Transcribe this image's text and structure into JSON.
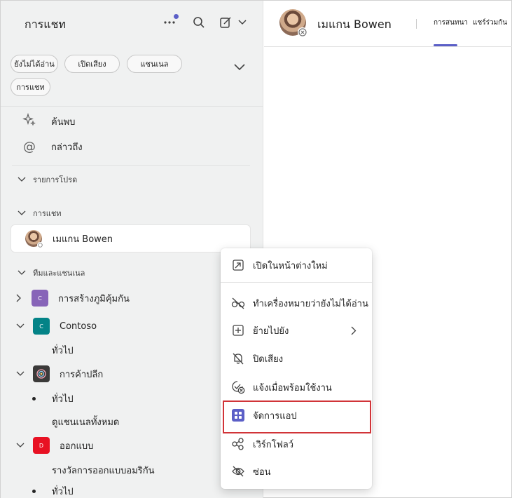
{
  "sidebar": {
    "title": "การแชท",
    "filters": [
      "ยังไม่ได้อ่าน",
      "เปิดเสียง",
      "แชนเนล",
      "การแชท"
    ],
    "nav": [
      {
        "label": "ค้นพบ",
        "icon": "sparkle-icon"
      },
      {
        "label": "กล่าวถึง",
        "icon": "at-icon"
      }
    ],
    "sections": {
      "favorites": "รายการโปรด",
      "chats": "การแชท",
      "teams": "ทีมและแชนเนล"
    },
    "chat_item": {
      "name": "เมแกน Bowen"
    },
    "teams": [
      {
        "name": "การสร้างภูมิคุ้มกัน",
        "initial": "C",
        "color": "#8764b8"
      },
      {
        "name": "Contoso",
        "initial": "C",
        "color": "#038387"
      },
      {
        "name": "การค้าปลีก",
        "initial": "",
        "color": "#3b3a39"
      },
      {
        "name": "ออกแบบ",
        "initial": "D",
        "color": "#e81123"
      }
    ],
    "channels": {
      "contoso_general": "ทั่วไป",
      "retail_general": "ทั่วไป",
      "retail_all": "ดูแชนเนลทั้งหมด",
      "design_award": "รางวัลการออกแบบอมริกัน",
      "design_general": "ทั่วไป"
    }
  },
  "main": {
    "name": "เมแกน Bowen",
    "tabs": [
      "การสนทนา",
      "แชร์ร่วมกัน"
    ]
  },
  "context_menu": {
    "items": [
      {
        "label": "เปิดในหน้าต่างใหม่",
        "icon": "open-new-window-icon"
      },
      {
        "label": "ทำเครื่องหมายว่ายังไม่ได้อ่าน",
        "icon": "mark-unread-icon"
      },
      {
        "label": "ย้ายไปยัง",
        "icon": "move-to-icon"
      },
      {
        "label": "ปิดเสียง",
        "icon": "mute-bell-icon"
      },
      {
        "label": "แจ้งเมื่อพร้อมใช้งาน",
        "icon": "notify-available-icon"
      },
      {
        "label": "จัดการแอป",
        "icon": "manage-apps-icon"
      },
      {
        "label": "เวิร์กโฟลว์",
        "icon": "workflow-icon"
      },
      {
        "label": "ซ่อน",
        "icon": "hide-icon"
      }
    ]
  },
  "colors": {
    "accent": "#5b5fc7",
    "highlight_border": "#d13438"
  }
}
